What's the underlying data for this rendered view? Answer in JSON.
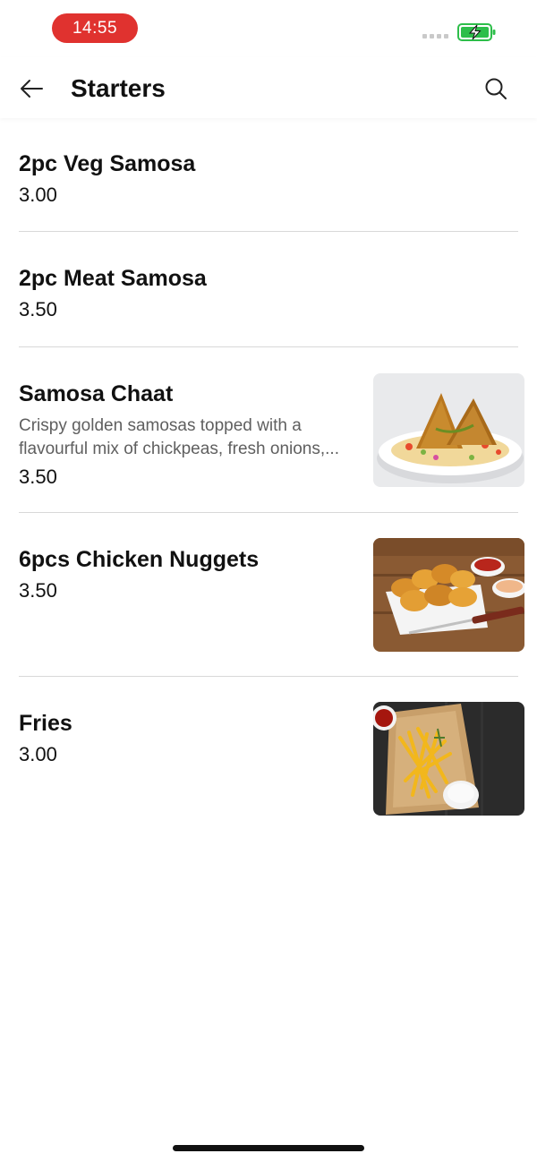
{
  "status_bar": {
    "time": "14:55",
    "time_pill_color": "#e0322f",
    "battery_icon": "battery-charging-icon",
    "battery_color": "#2dbe4a"
  },
  "header": {
    "back_icon": "arrow-left-icon",
    "title": "Starters",
    "search_icon": "search-icon"
  },
  "items": [
    {
      "name": "2pc Veg Samosa",
      "price": "3.00"
    },
    {
      "name": "2pc Meat Samosa",
      "price": "3.50"
    },
    {
      "name": "Samosa Chaat",
      "description_line1": "Crispy golden samosas topped with a",
      "description_line2": "flavourful mix of chickpeas, fresh onions,...",
      "price": "3.50",
      "image": "samosa-chaat-photo"
    },
    {
      "name": "6pcs Chicken Nuggets",
      "price": "3.50",
      "image": "chicken-nuggets-photo"
    },
    {
      "name": "Fries",
      "price": "3.00",
      "image": "fries-photo"
    }
  ]
}
